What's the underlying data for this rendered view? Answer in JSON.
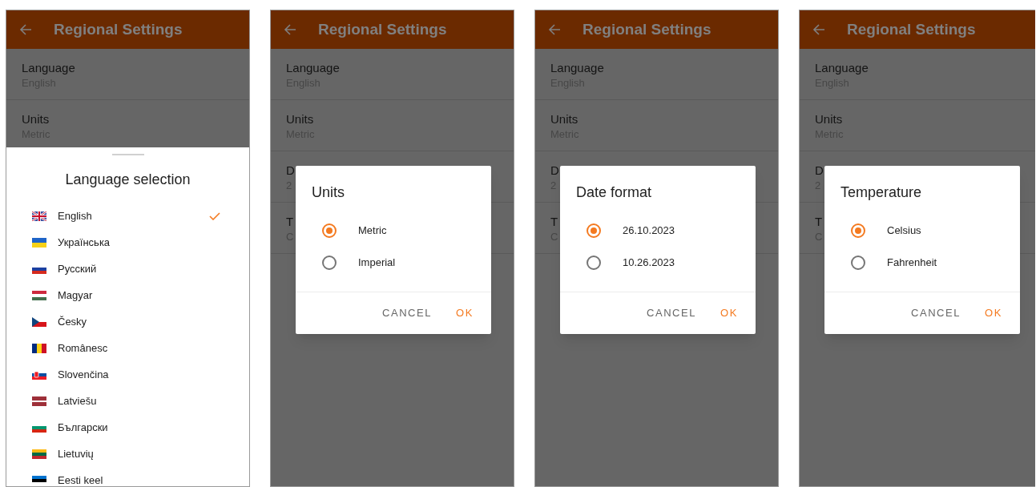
{
  "screens": [
    {
      "app_bar": {
        "title": "Regional Settings"
      },
      "settings": [
        {
          "label": "Language",
          "value": "English"
        },
        {
          "label": "Units",
          "value": "Metric"
        }
      ],
      "overlay": {
        "kind": "sheet",
        "title": "Language selection",
        "languages": [
          {
            "name": "English",
            "kind": "gb",
            "selected": true
          },
          {
            "name": "Українська",
            "kind": "ua",
            "selected": false
          },
          {
            "name": "Русский",
            "kind": "ru",
            "selected": false
          },
          {
            "name": "Magyar",
            "kind": "hu",
            "selected": false
          },
          {
            "name": "Česky",
            "kind": "cz",
            "selected": false
          },
          {
            "name": "Românesc",
            "kind": "ro",
            "selected": false
          },
          {
            "name": "Slovenčina",
            "kind": "sk",
            "selected": false
          },
          {
            "name": "Latviešu",
            "kind": "lv",
            "selected": false
          },
          {
            "name": "Български",
            "kind": "bg",
            "selected": false
          },
          {
            "name": "Lietuvių",
            "kind": "lt",
            "selected": false
          },
          {
            "name": "Eesti keel",
            "kind": "ee",
            "selected": false
          }
        ]
      }
    },
    {
      "app_bar": {
        "title": "Regional Settings"
      },
      "settings": [
        {
          "label": "Language",
          "value": "English"
        },
        {
          "label": "Units",
          "value": "Metric"
        },
        {
          "label": "D",
          "value": "2"
        },
        {
          "label": "T",
          "value": "C"
        }
      ],
      "overlay": {
        "kind": "dialog",
        "title": "Units",
        "options": [
          {
            "label": "Metric",
            "selected": true
          },
          {
            "label": "Imperial",
            "selected": false
          }
        ],
        "buttons": [
          {
            "label": "CANCEL",
            "kind": "cancel"
          },
          {
            "label": "OK",
            "kind": "confirm"
          }
        ]
      }
    },
    {
      "app_bar": {
        "title": "Regional Settings"
      },
      "settings": [
        {
          "label": "Language",
          "value": "English"
        },
        {
          "label": "Units",
          "value": "Metric"
        },
        {
          "label": "D",
          "value": "2"
        },
        {
          "label": "T",
          "value": "C"
        }
      ],
      "overlay": {
        "kind": "dialog",
        "title": "Date format",
        "options": [
          {
            "label": "26.10.2023",
            "selected": true
          },
          {
            "label": "10.26.2023",
            "selected": false
          }
        ],
        "buttons": [
          {
            "label": "CANCEL",
            "kind": "cancel"
          },
          {
            "label": "OK",
            "kind": "confirm"
          }
        ]
      }
    },
    {
      "app_bar": {
        "title": "Regional Settings"
      },
      "settings": [
        {
          "label": "Language",
          "value": "English"
        },
        {
          "label": "Units",
          "value": "Metric"
        },
        {
          "label": "D",
          "value": "2"
        },
        {
          "label": "T",
          "value": "C"
        }
      ],
      "overlay": {
        "kind": "dialog",
        "title": "Temperature",
        "options": [
          {
            "label": "Celsius",
            "selected": true
          },
          {
            "label": "Fahrenheit",
            "selected": false
          }
        ],
        "buttons": [
          {
            "label": "CANCEL",
            "kind": "cancel"
          },
          {
            "label": "OK",
            "kind": "confirm"
          }
        ]
      }
    }
  ]
}
